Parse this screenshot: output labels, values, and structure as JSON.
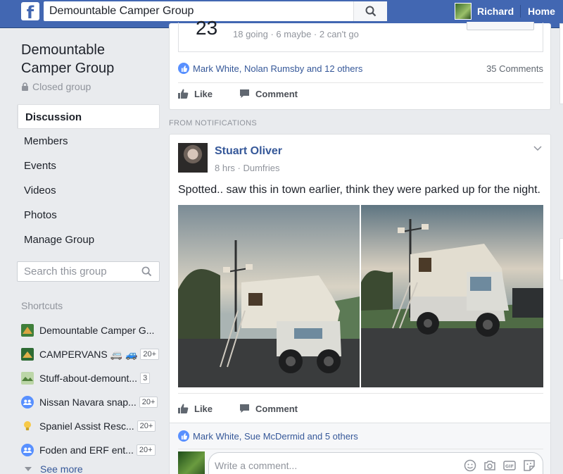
{
  "topbar": {
    "logo": "f",
    "search_value": "Demountable Camper Group",
    "user_name": "Richard",
    "home_label": "Home"
  },
  "sidebar": {
    "group_title": "Demountable Camper Group",
    "privacy": "Closed group",
    "nav": [
      {
        "label": "Discussion",
        "active": true
      },
      {
        "label": "Members"
      },
      {
        "label": "Events"
      },
      {
        "label": "Videos"
      },
      {
        "label": "Photos"
      },
      {
        "label": "Manage Group"
      }
    ],
    "search_placeholder": "Search this group",
    "shortcuts_heading": "Shortcuts",
    "shortcuts": [
      {
        "label": "Demountable Camper G...",
        "badge": "",
        "icon": "camper-group-icon"
      },
      {
        "label": "CAMPERVANS 🚐 🚙",
        "badge": "20+",
        "icon": "campervans-group-icon"
      },
      {
        "label": "Stuff-about-demount...",
        "badge": "3",
        "icon": "stuff-group-icon"
      },
      {
        "label": "Nissan Navara snap...",
        "badge": "20+",
        "icon": "group-people-icon"
      },
      {
        "label": "Spaniel Assist Resc...",
        "badge": "20+",
        "icon": "lightbulb-icon"
      },
      {
        "label": "Foden and ERF ent...",
        "badge": "20+",
        "icon": "group-people-icon"
      }
    ],
    "see_more": "See more"
  },
  "event_post": {
    "day": "23",
    "stats": "18 going · 6 maybe · 2 can't go",
    "likes": "Mark White, Nolan Rumsby and 12 others",
    "comments_count": "35 Comments",
    "like_label": "Like",
    "comment_label": "Comment"
  },
  "notifications_heading": "FROM NOTIFICATIONS",
  "post": {
    "author": "Stuart Oliver",
    "meta": "8 hrs · Dumfries",
    "text": "Spotted.. saw this in town earlier, think they were parked up for the night.",
    "like_label": "Like",
    "comment_label": "Comment",
    "likes": "Mark White, Sue McDermid and 5 others",
    "comment_placeholder": "Write a comment..."
  },
  "colors": {
    "brand": "#4267b2",
    "link": "#365899",
    "background": "#e9ebee"
  }
}
